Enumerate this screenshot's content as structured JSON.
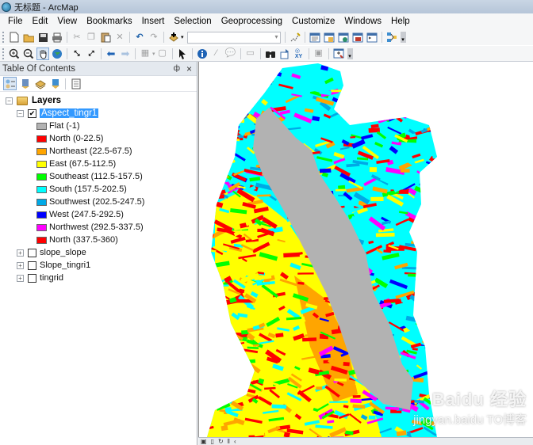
{
  "window": {
    "title": "无标题 - ArcMap"
  },
  "menubar": [
    "File",
    "Edit",
    "View",
    "Bookmarks",
    "Insert",
    "Selection",
    "Geoprocessing",
    "Customize",
    "Windows",
    "Help"
  ],
  "toolbar1": {
    "scale_value": "",
    "icons": [
      "new-document",
      "open-folder",
      "save",
      "print",
      "cut",
      "copy",
      "paste",
      "delete",
      "undo",
      "redo",
      "add-data",
      "scale-combo",
      "editor",
      "table-of-contents-window",
      "catalog-window",
      "search-window",
      "arctoolbox-window",
      "python-window",
      "model-builder"
    ]
  },
  "toolbar2": {
    "icons": [
      "zoom-in",
      "zoom-out",
      "pan",
      "full-extent",
      "fixed-zoom-in",
      "fixed-zoom-out",
      "back-extent",
      "forward-extent",
      "select-by-graphics",
      "clear-selection",
      "select-elements",
      "identify",
      "html-popup",
      "hyperlink",
      "measure",
      "find",
      "go-to-xy",
      "xy",
      "time-slider",
      "create-viewer-window"
    ],
    "active_tool": "pan"
  },
  "toc": {
    "title": "Table Of Contents",
    "pin_glyph": "ф",
    "close_glyph": "×",
    "tools": [
      "list-by-drawing-order",
      "list-by-source",
      "list-by-visibility",
      "list-by-selection",
      "options"
    ],
    "root": {
      "label": "Layers",
      "expanded": true
    },
    "layers": [
      {
        "name": "Aspect_tingr1",
        "checked": true,
        "expanded": true,
        "selected": true,
        "legend": [
          {
            "label": "Flat (-1)",
            "color": "#b2b2b2"
          },
          {
            "label": "North (0-22.5)",
            "color": "#ff0000"
          },
          {
            "label": "Northeast (22.5-67.5)",
            "color": "#ffa500"
          },
          {
            "label": "East (67.5-112.5)",
            "color": "#ffff00"
          },
          {
            "label": "Southeast (112.5-157.5)",
            "color": "#00ff00"
          },
          {
            "label": "South (157.5-202.5)",
            "color": "#00ffff"
          },
          {
            "label": "Southwest (202.5-247.5)",
            "color": "#00a9e6"
          },
          {
            "label": "West (247.5-292.5)",
            "color": "#0000ff"
          },
          {
            "label": "Northwest (292.5-337.5)",
            "color": "#ff00ff"
          },
          {
            "label": "North (337.5-360)",
            "color": "#ff0000"
          }
        ]
      },
      {
        "name": "slope_slope",
        "checked": false,
        "expanded": false
      },
      {
        "name": "Slope_tingri1",
        "checked": false,
        "expanded": false
      },
      {
        "name": "tingrid",
        "checked": false,
        "expanded": false
      }
    ]
  },
  "statusbar": {
    "icons": [
      "data-view",
      "layout-view",
      "refresh",
      "pause",
      "previous"
    ]
  },
  "watermark": {
    "line1": "Baidu 经验",
    "line2": "jingyan.baidu  TO博客"
  }
}
